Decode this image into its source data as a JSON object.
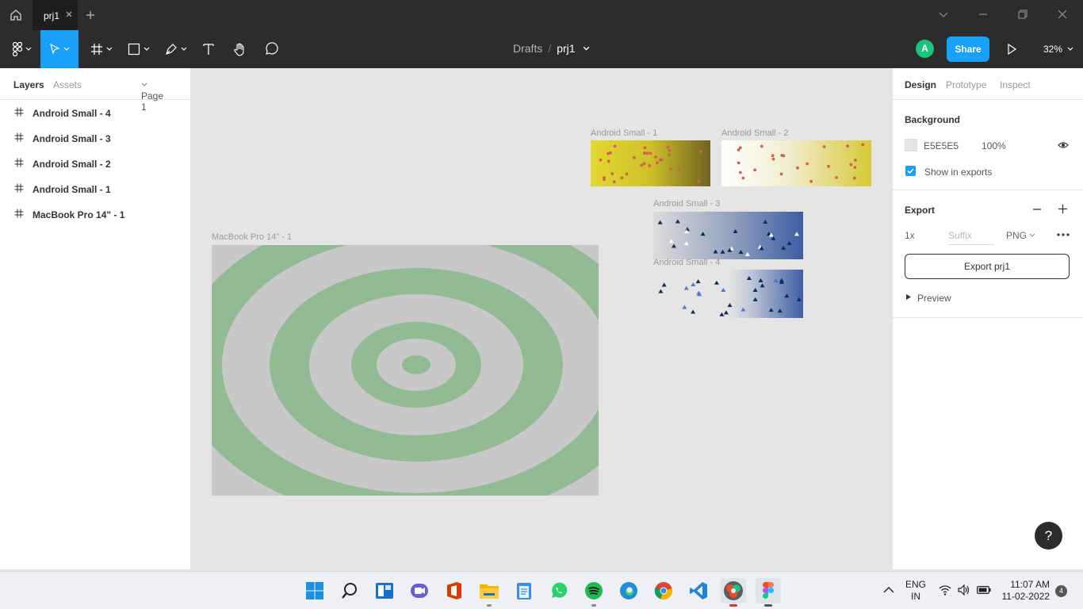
{
  "titlebar": {
    "tab_title": "prj1",
    "home_icon": "home-icon",
    "close_tab_icon": "close-icon",
    "new_tab_icon": "plus-icon"
  },
  "toolbar": {
    "breadcrumb_root": "Drafts",
    "breadcrumb_sep": "/",
    "file_name": "prj1",
    "avatar_letter": "A",
    "share_label": "Share",
    "zoom": "32%"
  },
  "left_panel": {
    "tab_layers": "Layers",
    "tab_assets": "Assets",
    "page": "Page 1",
    "layers": [
      "Android Small - 4",
      "Android Small - 3",
      "Android Small - 2",
      "Android Small - 1",
      "MacBook Pro 14\" - 1"
    ]
  },
  "canvas": {
    "frames": {
      "android1": "Android Small - 1",
      "android2": "Android Small - 2",
      "android3": "Android Small - 3",
      "android4": "Android Small - 4",
      "macbook": "MacBook Pro 14\" - 1"
    }
  },
  "right_panel": {
    "tab_design": "Design",
    "tab_prototype": "Prototype",
    "tab_inspect": "Inspect",
    "background_title": "Background",
    "bg_hex": "E5E5E5",
    "bg_opacity": "100%",
    "show_in_exports": "Show in exports",
    "export_title": "Export",
    "export_scale": "1x",
    "suffix_placeholder": "Suffix",
    "format": "PNG",
    "export_button": "Export prj1",
    "preview": "Preview"
  },
  "help": "?",
  "taskbar": {
    "lang_top": "ENG",
    "lang_bottom": "IN",
    "time": "11:07 AM",
    "date": "11-02-2022",
    "notification_count": "4"
  },
  "colors": {
    "accent": "#18a0fb",
    "avatar": "#1bc47d",
    "ring_green": "#93bb93",
    "ring_gray": "#c8c8c8"
  }
}
